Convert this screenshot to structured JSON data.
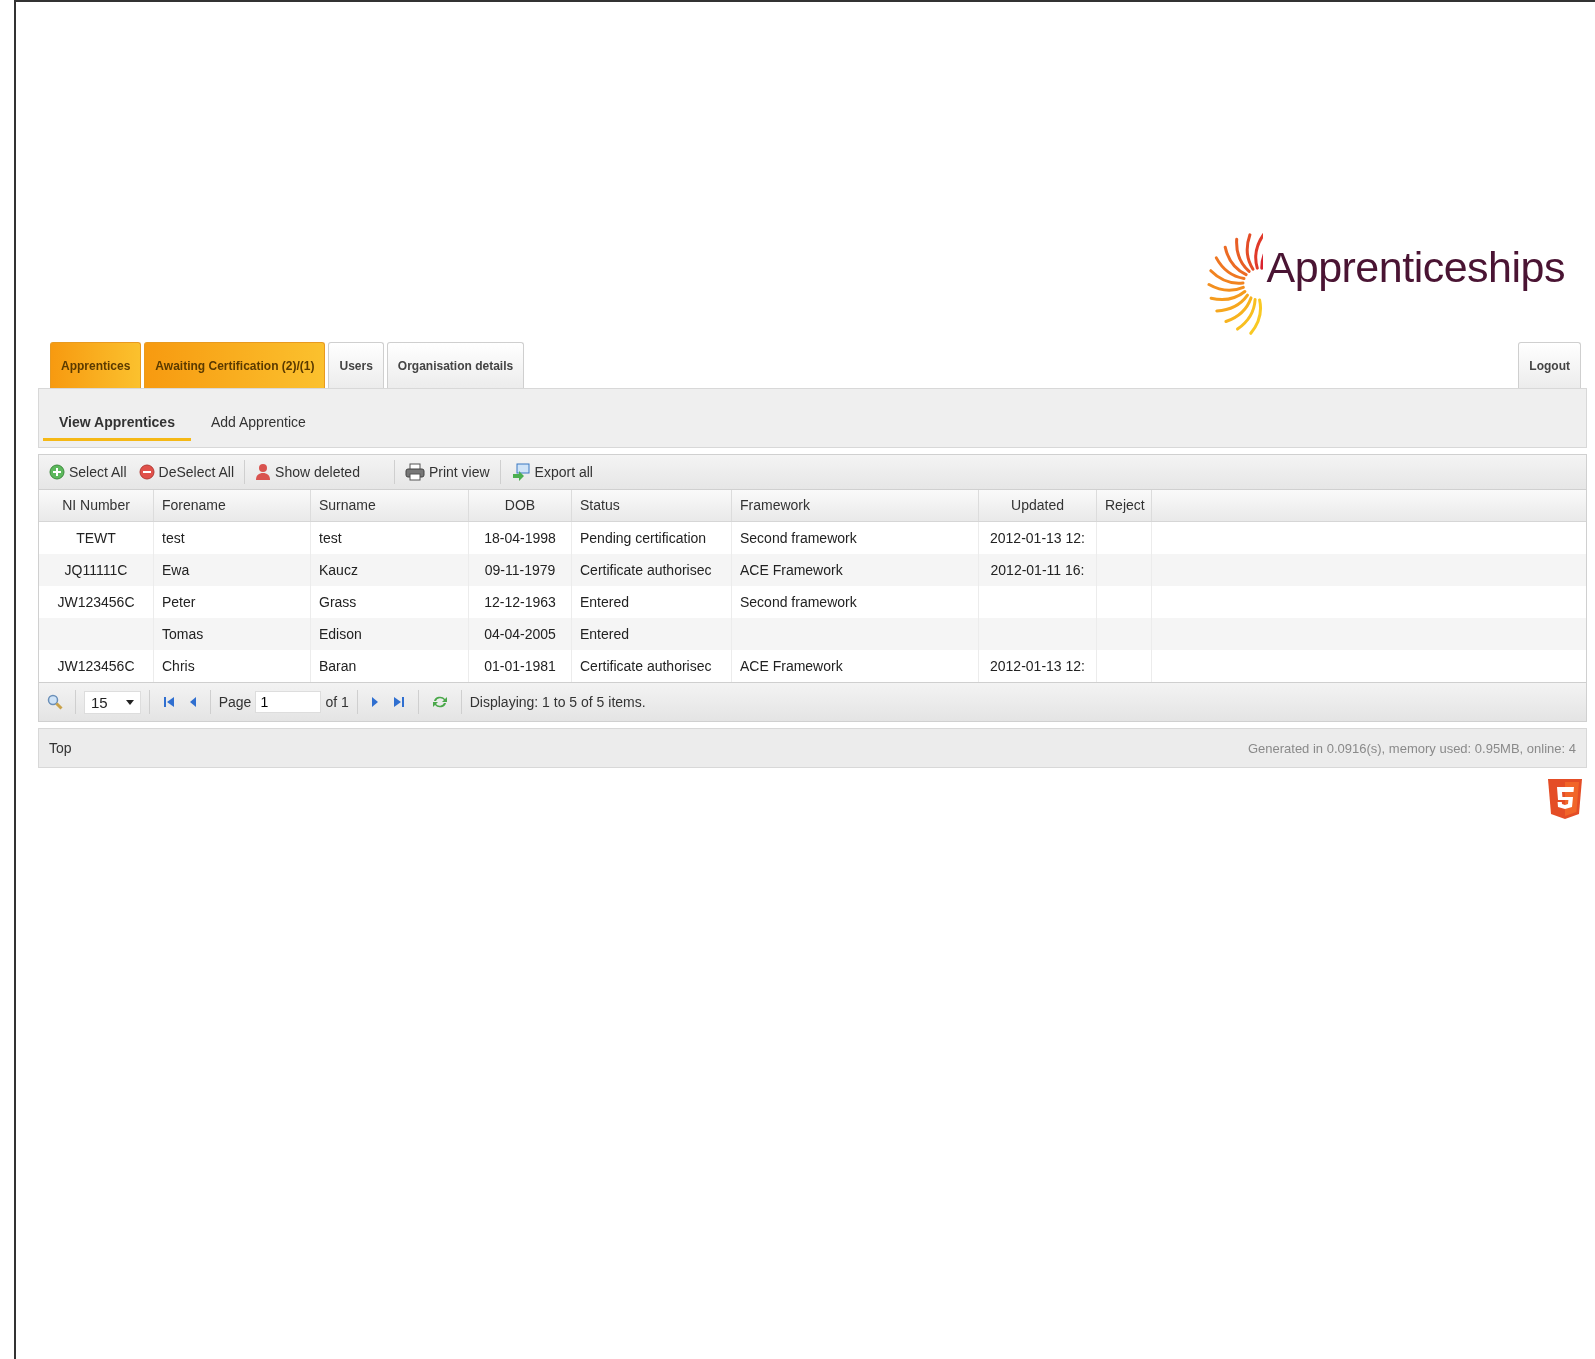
{
  "logo": {
    "text": "Apprenticeships"
  },
  "tabs": [
    {
      "label": "Apprentices",
      "active": true
    },
    {
      "label": "Awaiting Certification (2)/(1)",
      "active": true
    },
    {
      "label": "Users",
      "active": false
    },
    {
      "label": "Organisation details",
      "active": false
    }
  ],
  "logout": {
    "label": "Logout"
  },
  "subtabs": [
    {
      "label": "View Apprentices",
      "selected": true
    },
    {
      "label": "Add Apprentice",
      "selected": false
    }
  ],
  "toolbar": [
    {
      "kind": "select",
      "label": "Select All"
    },
    {
      "kind": "deselect",
      "label": "DeSelect All"
    },
    {
      "kind": "person",
      "label": "Show deleted"
    },
    {
      "kind": "print",
      "label": "Print view"
    },
    {
      "kind": "export",
      "label": "Export all"
    }
  ],
  "table": {
    "columns": [
      {
        "label": "NI Number",
        "kind": "center"
      },
      {
        "label": "Forename",
        "kind": "left"
      },
      {
        "label": "Surname",
        "kind": "left"
      },
      {
        "label": "DOB",
        "kind": "center"
      },
      {
        "label": "Status",
        "kind": "left"
      },
      {
        "label": "Framework",
        "kind": "left"
      },
      {
        "label": "Updated",
        "kind": "center"
      },
      {
        "label": "Reject",
        "kind": "left"
      }
    ],
    "rows": [
      [
        "TEWT",
        "test",
        "test",
        "18-04-1998",
        "Pending certification",
        "Second framework",
        "2012-01-13 12:",
        ""
      ],
      [
        "JQ11111C",
        "Ewa",
        "Kaucz",
        "09-11-1979",
        "Certificate authorisec",
        "ACE Framework",
        "2012-01-11 16:",
        ""
      ],
      [
        "JW123456C",
        "Peter",
        "Grass",
        "12-12-1963",
        "Entered",
        "Second framework",
        "",
        ""
      ],
      [
        "",
        "Tomas",
        "Edison",
        "04-04-2005",
        "Entered",
        "",
        "",
        ""
      ],
      [
        "JW123456C",
        "Chris",
        "Baran",
        "01-01-1981",
        "Certificate authorisec",
        "ACE Framework",
        "2012-01-13 12:",
        ""
      ]
    ]
  },
  "pager": {
    "page_size": "15",
    "page_label": "Page",
    "page": "1",
    "of": "of 1",
    "display": "Displaying: 1 to 5 of 5 items."
  },
  "footer": {
    "top_link": "Top",
    "stats": "Generated in 0.0916(s), memory used: 0.95MB, online: 4"
  }
}
